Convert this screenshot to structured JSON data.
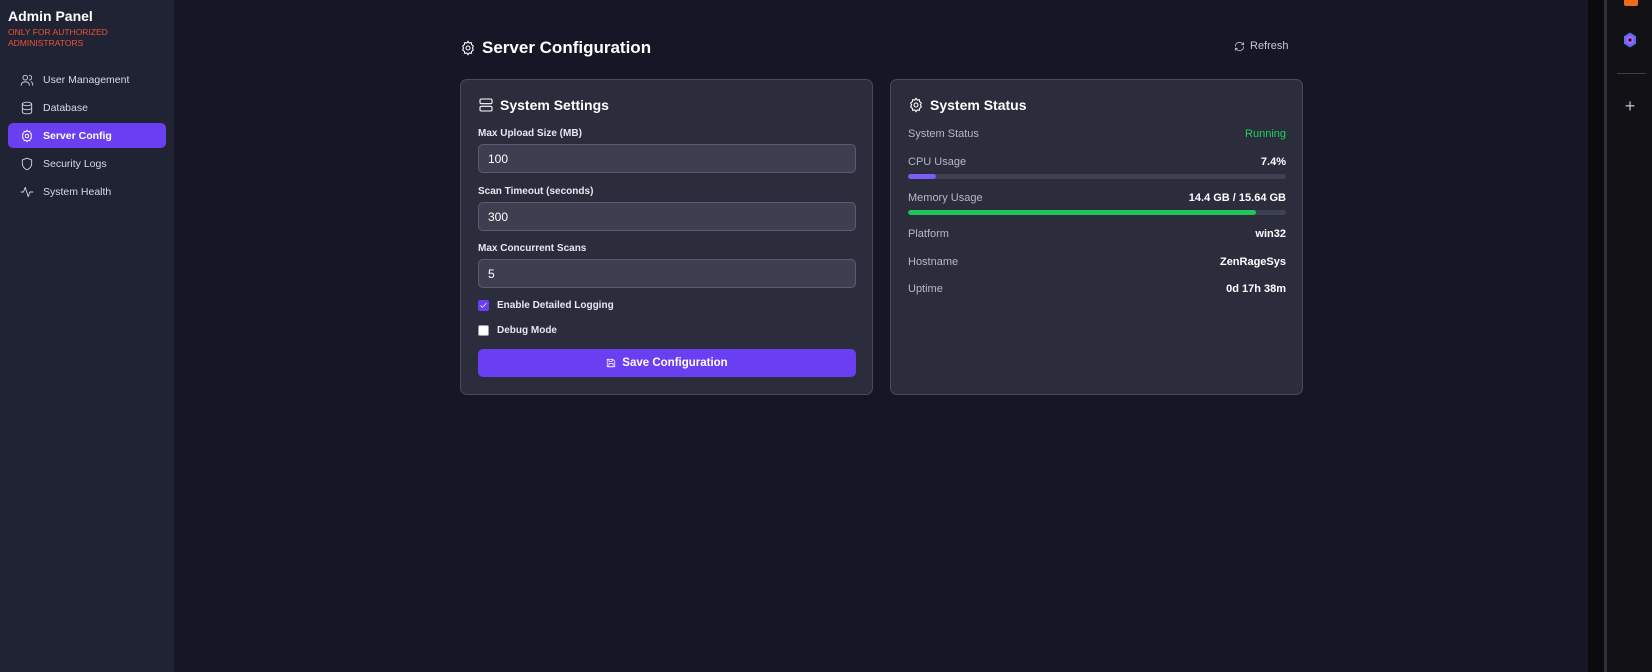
{
  "sidebar": {
    "title": "Admin Panel",
    "subtitle": "ONLY FOR AUTHORIZED ADMINISTRATORS",
    "items": [
      {
        "label": "User Management",
        "icon": "users-icon"
      },
      {
        "label": "Database",
        "icon": "database-icon"
      },
      {
        "label": "Server Config",
        "icon": "gear-icon",
        "active": true
      },
      {
        "label": "Security Logs",
        "icon": "shield-icon"
      },
      {
        "label": "System Health",
        "icon": "activity-icon"
      }
    ]
  },
  "header": {
    "title": "Server Configuration",
    "refresh_label": "Refresh"
  },
  "settings": {
    "title": "System Settings",
    "fields": [
      {
        "label": "Max Upload Size (MB)",
        "value": "100"
      },
      {
        "label": "Scan Timeout (seconds)",
        "value": "300"
      },
      {
        "label": "Max Concurrent Scans",
        "value": "5"
      }
    ],
    "checkboxes": [
      {
        "label": "Enable Detailed Logging",
        "checked": true
      },
      {
        "label": "Debug Mode",
        "checked": false
      }
    ],
    "save_label": "Save Configuration"
  },
  "status": {
    "title": "System Status",
    "system_status_label": "System Status",
    "system_status_value": "Running",
    "cpu_label": "CPU Usage",
    "cpu_value": "7.4%",
    "cpu_fraction": 0.074,
    "memory_label": "Memory Usage",
    "memory_value": "14.4 GB / 15.64 GB",
    "memory_fraction": 0.921,
    "platform_label": "Platform",
    "platform_value": "win32",
    "hostname_label": "Hostname",
    "hostname_value": "ZenRageSys",
    "uptime_label": "Uptime",
    "uptime_value": "0d 17h 38m"
  },
  "colors": {
    "accent": "#6a3ff2",
    "cpu_bar": "#7b5cf5",
    "memory_bar": "#1fc45a",
    "ok": "#1fd15f",
    "warning_text": "#e8533a"
  }
}
